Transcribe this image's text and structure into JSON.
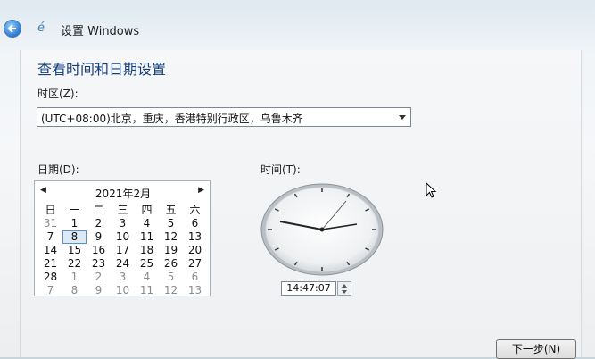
{
  "window": {
    "title": "设置 Windows",
    "icon_text": "é"
  },
  "page": {
    "heading": "查看时间和日期设置"
  },
  "timezone": {
    "label": "时区(Z):",
    "value": "(UTC+08:00)北京，重庆，香港特别行政区，乌鲁木齐"
  },
  "date": {
    "label": "日期(D):",
    "month_title": "2021年2月",
    "prev": "◀",
    "next": "▶",
    "weekdays": [
      "日",
      "一",
      "二",
      "三",
      "四",
      "五",
      "六"
    ],
    "weeks": [
      [
        "31",
        "1",
        "2",
        "3",
        "4",
        "5",
        "6"
      ],
      [
        "7",
        "8",
        "9",
        "10",
        "11",
        "12",
        "13"
      ],
      [
        "14",
        "15",
        "16",
        "17",
        "18",
        "19",
        "20"
      ],
      [
        "21",
        "22",
        "23",
        "24",
        "25",
        "26",
        "27"
      ],
      [
        "28",
        "1",
        "2",
        "3",
        "4",
        "5",
        "6"
      ],
      [
        "7",
        "8",
        "9",
        "10",
        "11",
        "12",
        "13"
      ]
    ]
  },
  "time": {
    "label": "时间(T):",
    "value": "14:47:07"
  },
  "buttons": {
    "next": "下一步(N)"
  },
  "colors": {
    "heading": "#153f7a",
    "today_border": "#5c8fc8"
  }
}
